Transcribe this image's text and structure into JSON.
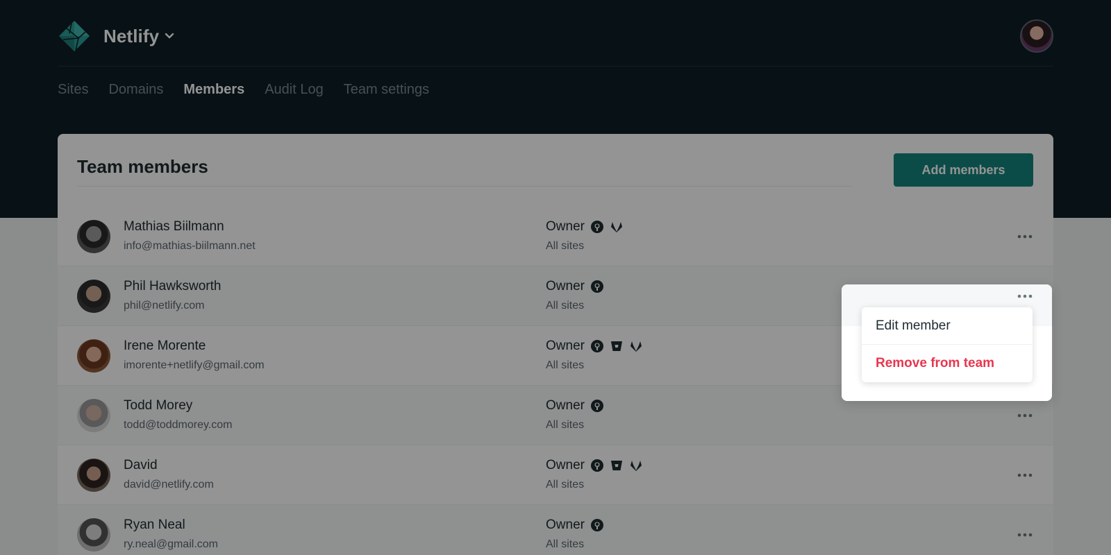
{
  "header": {
    "team_name": "Netlify",
    "nav": [
      {
        "label": "Sites"
      },
      {
        "label": "Domains"
      },
      {
        "label": "Members"
      },
      {
        "label": "Audit Log"
      },
      {
        "label": "Team settings"
      }
    ],
    "active_nav": "Members"
  },
  "card": {
    "title": "Team members",
    "add_button_label": "Add members"
  },
  "members": [
    {
      "name": "Mathias Biilmann",
      "email": "info@mathias-biilmann.net",
      "role": "Owner",
      "scope": "All sites",
      "providers": [
        "github-icon",
        "gitlab-icon"
      ]
    },
    {
      "name": "Phil Hawksworth",
      "email": "phil@netlify.com",
      "role": "Owner",
      "scope": "All sites",
      "providers": [
        "github-icon"
      ]
    },
    {
      "name": "Irene Morente",
      "email": "imorente+netlify@gmail.com",
      "role": "Owner",
      "scope": "All sites",
      "providers": [
        "github-icon",
        "bitbucket-icon",
        "gitlab-icon"
      ]
    },
    {
      "name": "Todd Morey",
      "email": "todd@toddmorey.com",
      "role": "Owner",
      "scope": "All sites",
      "providers": [
        "github-icon"
      ]
    },
    {
      "name": "David",
      "email": "david@netlify.com",
      "role": "Owner",
      "scope": "All sites",
      "providers": [
        "github-icon",
        "bitbucket-icon",
        "gitlab-icon"
      ]
    },
    {
      "name": "Ryan Neal",
      "email": "ry.neal@gmail.com",
      "role": "Owner",
      "scope": "All sites",
      "providers": [
        "github-icon"
      ]
    }
  ],
  "dropdown_menu": {
    "edit_label": "Edit member",
    "remove_label": "Remove from team"
  },
  "colors": {
    "header_bg": "#0e1e25",
    "accent_teal": "#15847d",
    "danger_red": "#e8364f",
    "logo_teal": "#2a9d96"
  }
}
